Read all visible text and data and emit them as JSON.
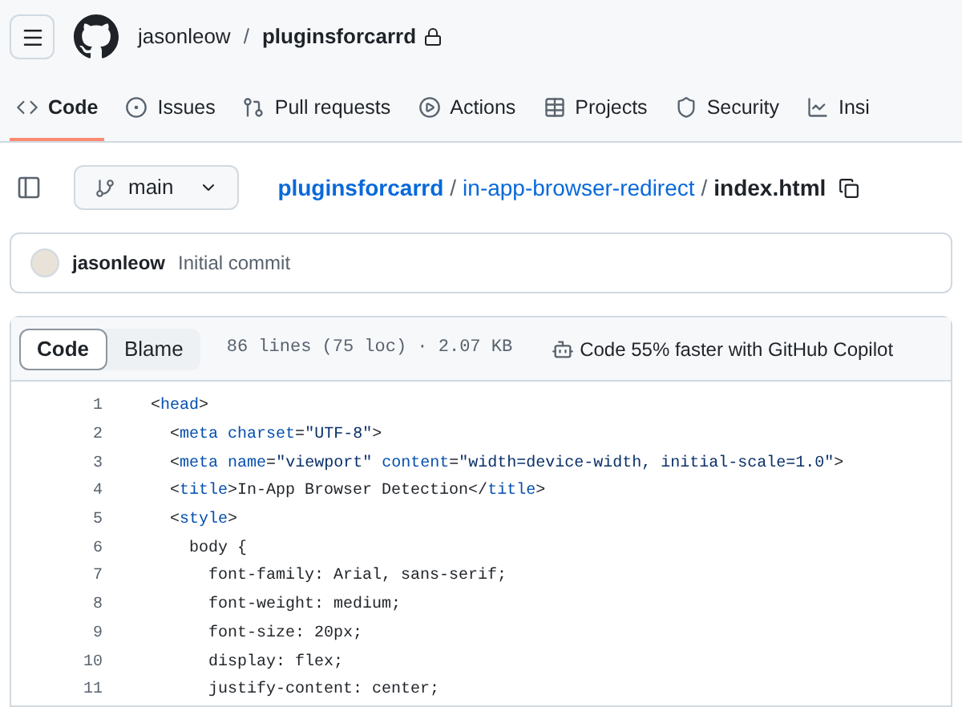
{
  "header": {
    "owner": "jasonleow",
    "separator": "/",
    "repo": "pluginsforcarrd"
  },
  "tabs": [
    {
      "label": "Code",
      "kind": "code",
      "selected": true
    },
    {
      "label": "Issues",
      "kind": "issue",
      "selected": false
    },
    {
      "label": "Pull requests",
      "kind": "pr",
      "selected": false
    },
    {
      "label": "Actions",
      "kind": "play",
      "selected": false
    },
    {
      "label": "Projects",
      "kind": "table",
      "selected": false
    },
    {
      "label": "Security",
      "kind": "shield",
      "selected": false
    },
    {
      "label": "Insi",
      "kind": "graph",
      "selected": false
    }
  ],
  "branch": "main",
  "breadcrumb": [
    {
      "text": "pluginsforcarrd",
      "kind": "root"
    },
    {
      "text": "/",
      "kind": "sep"
    },
    {
      "text": "in-app-browser-redirect",
      "kind": "link"
    },
    {
      "text": "/",
      "kind": "sep"
    },
    {
      "text": "index.html",
      "kind": "file"
    }
  ],
  "commit": {
    "author": "jasonleow",
    "message": "Initial commit"
  },
  "file_tabs": [
    {
      "label": "Code",
      "selected": true
    },
    {
      "label": "Blame",
      "selected": false
    }
  ],
  "file_info": "86 lines (75 loc) · 2.07 KB",
  "copilot": "Code 55% faster with GitHub Copilot",
  "code_lines": [
    {
      "number": "1",
      "tokens": [
        {
          "kind": "text",
          "text": "<"
        },
        {
          "kind": "tag",
          "text": "head"
        },
        {
          "kind": "text",
          "text": ">"
        }
      ]
    },
    {
      "number": "2",
      "tokens": [
        {
          "kind": "text",
          "text": "  <"
        },
        {
          "kind": "tag",
          "text": "meta"
        },
        {
          "kind": "attr",
          "text": " charset"
        },
        {
          "kind": "text",
          "text": "="
        },
        {
          "kind": "str",
          "text": "\"UTF-8\""
        },
        {
          "kind": "text",
          "text": ">"
        }
      ]
    },
    {
      "number": "3",
      "tokens": [
        {
          "kind": "text",
          "text": "  <"
        },
        {
          "kind": "tag",
          "text": "meta"
        },
        {
          "kind": "attr",
          "text": " name"
        },
        {
          "kind": "text",
          "text": "="
        },
        {
          "kind": "str",
          "text": "\"viewport\""
        },
        {
          "kind": "attr",
          "text": " content"
        },
        {
          "kind": "text",
          "text": "="
        },
        {
          "kind": "str",
          "text": "\"width=device-width, initial-scale=1.0\""
        },
        {
          "kind": "text",
          "text": ">"
        }
      ]
    },
    {
      "number": "4",
      "tokens": [
        {
          "kind": "text",
          "text": "  <"
        },
        {
          "kind": "tag",
          "text": "title"
        },
        {
          "kind": "text",
          "text": ">In-App Browser Detection</"
        },
        {
          "kind": "tag",
          "text": "title"
        },
        {
          "kind": "text",
          "text": ">"
        }
      ]
    },
    {
      "number": "5",
      "tokens": [
        {
          "kind": "text",
          "text": "  <"
        },
        {
          "kind": "tag",
          "text": "style"
        },
        {
          "kind": "text",
          "text": ">"
        }
      ]
    },
    {
      "number": "6",
      "tokens": [
        {
          "kind": "text",
          "text": "    body {"
        }
      ]
    },
    {
      "number": "7",
      "tokens": [
        {
          "kind": "text",
          "text": "      font-family: Arial, sans-serif;"
        }
      ]
    },
    {
      "number": "8",
      "tokens": [
        {
          "kind": "text",
          "text": "      font-weight: medium;"
        }
      ]
    },
    {
      "number": "9",
      "tokens": [
        {
          "kind": "text",
          "text": "      font-size: 20px;"
        }
      ]
    },
    {
      "number": "10",
      "tokens": [
        {
          "kind": "text",
          "text": "      display: flex;"
        }
      ]
    },
    {
      "number": "11",
      "tokens": [
        {
          "kind": "text",
          "text": "      justify-content: center;"
        }
      ]
    }
  ]
}
